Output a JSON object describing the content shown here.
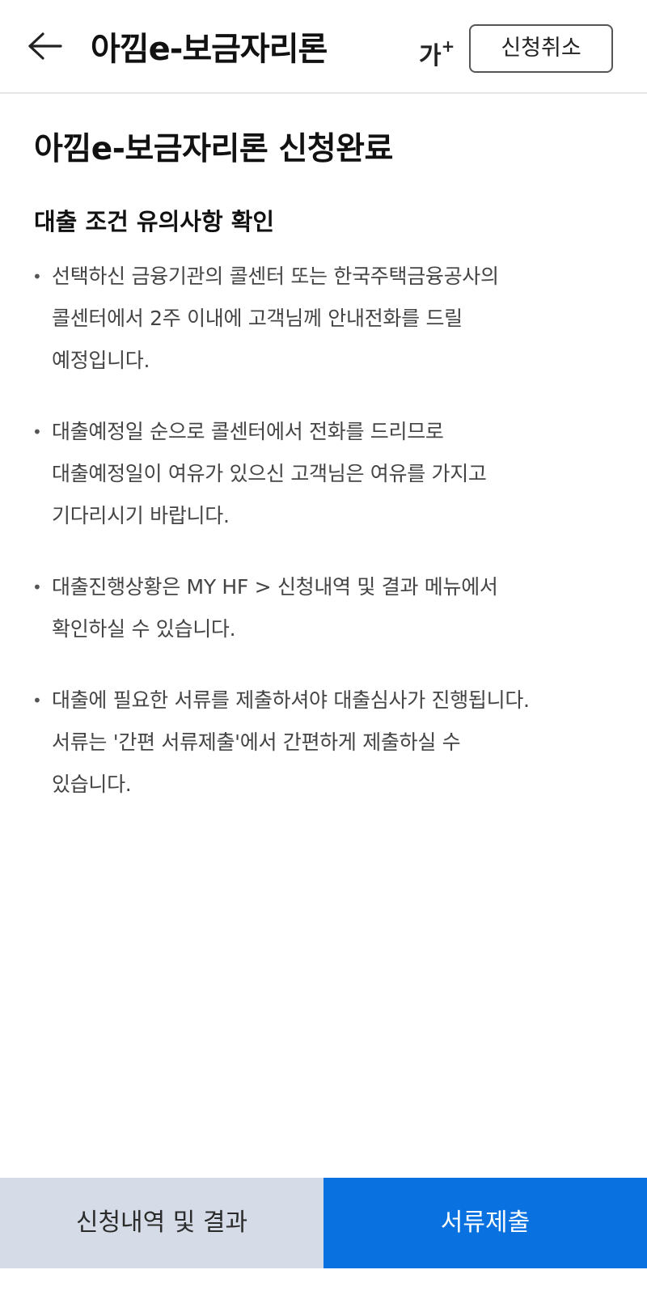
{
  "header": {
    "back_icon": "arrow-left-icon",
    "title": "아낌e-보금자리론",
    "font_size_label": "가",
    "font_size_sup": "+",
    "cancel_label": "신청취소"
  },
  "main": {
    "page_title": "아낌e-보금자리론 신청완료",
    "section_title": "대출 조건 유의사항 확인",
    "notices": [
      {
        "lines": [
          "선택하신 금융기관의 콜센터 또는 한국주택금융공사의",
          "콜센터에서 2주 이내에 고객님께 안내전화를 드릴",
          "예정입니다."
        ]
      },
      {
        "lines": [
          "대출예정일 순으로 콜센터에서 전화를 드리므로",
          "대출예정일이 여유가 있으신 고객님은 여유를 가지고",
          "기다리시기 바랍니다."
        ]
      },
      {
        "lines": [
          "대출진행상황은 MY HF > 신청내역 및 결과 메뉴에서",
          "확인하실 수 있습니다."
        ]
      },
      {
        "lines": [
          "대출에 필요한 서류를 제출하셔야 대출심사가 진행됩니다.",
          "서류는 '간편 서류제출'에서 간편하게 제출하실 수",
          "있습니다."
        ]
      }
    ],
    "bullet": "•"
  },
  "footer": {
    "history_label": "신청내역 및 결과",
    "submit_label": "서류제출"
  },
  "colors": {
    "primary": "#0a72e0",
    "secondary_button": "#d6dce7",
    "divider": "#e6e6e6"
  }
}
